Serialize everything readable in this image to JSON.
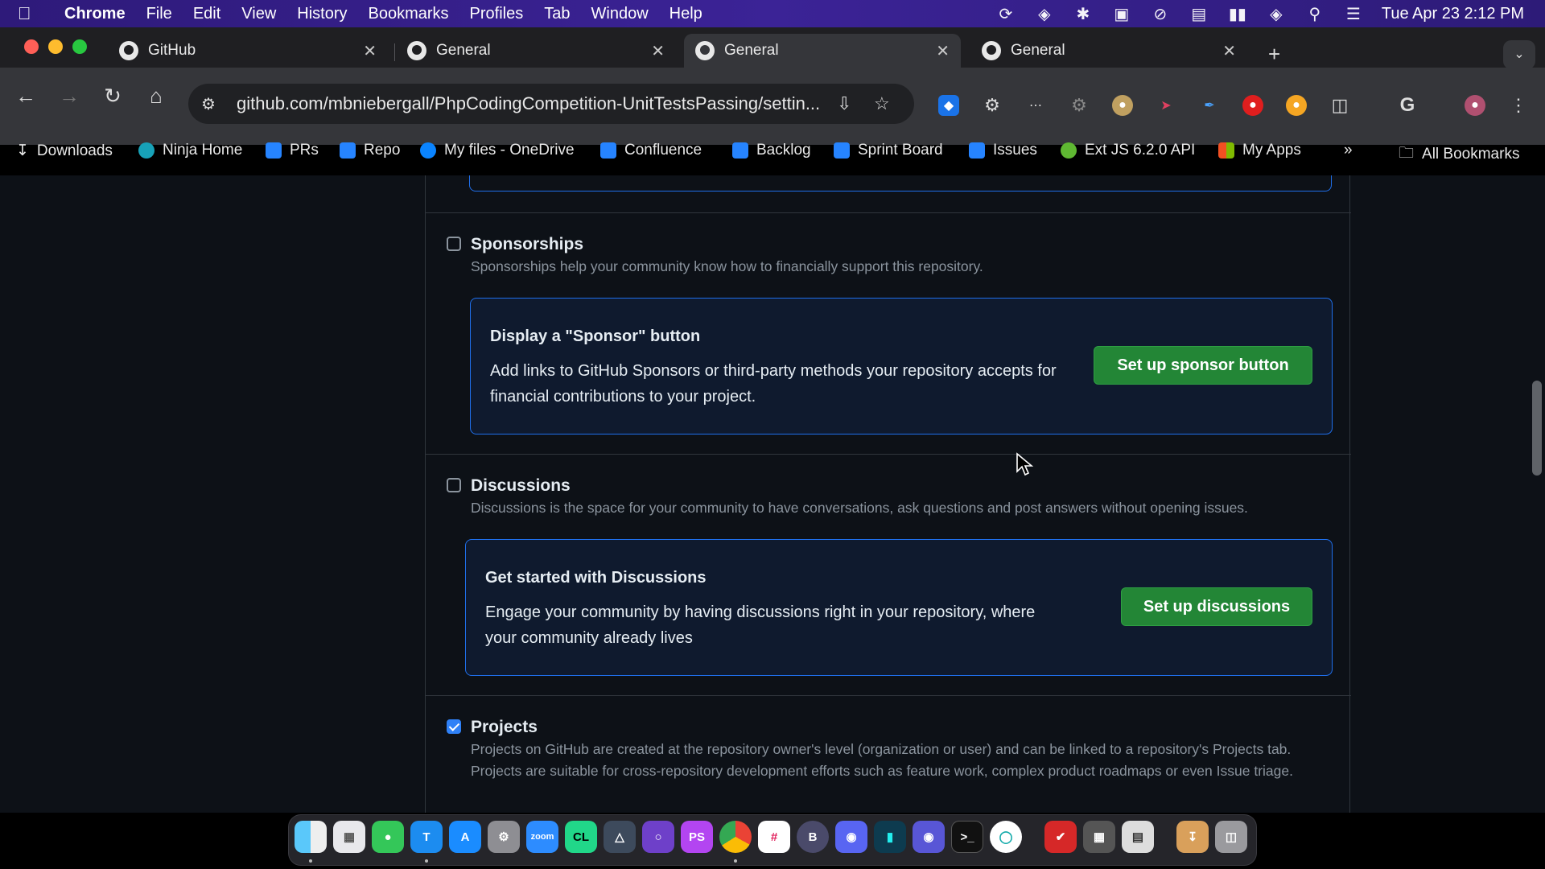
{
  "menubar": {
    "app": "Chrome",
    "items": [
      "File",
      "Edit",
      "View",
      "History",
      "Bookmarks",
      "Profiles",
      "Tab",
      "Window",
      "Help"
    ],
    "datetime": "Tue Apr 23  2:12 PM"
  },
  "tabs": [
    {
      "title": "GitHub",
      "active": false
    },
    {
      "title": "General",
      "active": false
    },
    {
      "title": "General",
      "active": true
    },
    {
      "title": "General",
      "active": false
    }
  ],
  "omnibox": {
    "url": "github.com/mbniebergall/PhpCodingCompetition-UnitTestsPassing/settin..."
  },
  "bookmarks": [
    {
      "label": "Downloads",
      "icon": "download-icon"
    },
    {
      "label": "Ninja Home",
      "icon": "ninja-icon"
    },
    {
      "label": "PRs",
      "icon": "bitbucket-icon"
    },
    {
      "label": "Repo",
      "icon": "bitbucket-icon"
    },
    {
      "label": "My files - OneDrive",
      "icon": "onedrive-icon"
    },
    {
      "label": "Confluence",
      "icon": "confluence-icon"
    },
    {
      "label": "Backlog",
      "icon": "jira-icon"
    },
    {
      "label": "Sprint Board",
      "icon": "jira-icon"
    },
    {
      "label": "Issues",
      "icon": "jira-icon"
    },
    {
      "label": "Ext JS 6.2.0 API",
      "icon": "extjs-icon"
    },
    {
      "label": "My Apps",
      "icon": "microsoft-icon"
    }
  ],
  "all_bookmarks": "All Bookmarks",
  "settings": {
    "sponsorships": {
      "title": "Sponsorships",
      "checked": false,
      "description": "Sponsorships help your community know how to financially support this repository.",
      "callout_title": "Display a \"Sponsor\" button",
      "callout_body": "Add links to GitHub Sponsors or third-party methods your repository accepts for financial contributions to your project.",
      "button": "Set up sponsor button"
    },
    "discussions": {
      "title": "Discussions",
      "checked": false,
      "description": "Discussions is the space for your community to have conversations, ask questions and post answers without opening issues.",
      "callout_title": "Get started with Discussions",
      "callout_body": "Engage your community by having discussions right in your repository, where your community already lives",
      "button": "Set up discussions"
    },
    "projects": {
      "title": "Projects",
      "checked": true,
      "description": "Projects on GitHub are created at the repository owner's level (organization or user) and can be linked to a repository's Projects tab. Projects are suitable for cross-repository development efforts such as feature work, complex product roadmaps or even Issue triage."
    }
  },
  "colors": {
    "page_bg": "#0d1117",
    "accent_blue": "#1f6feb",
    "button_green": "#238636"
  }
}
